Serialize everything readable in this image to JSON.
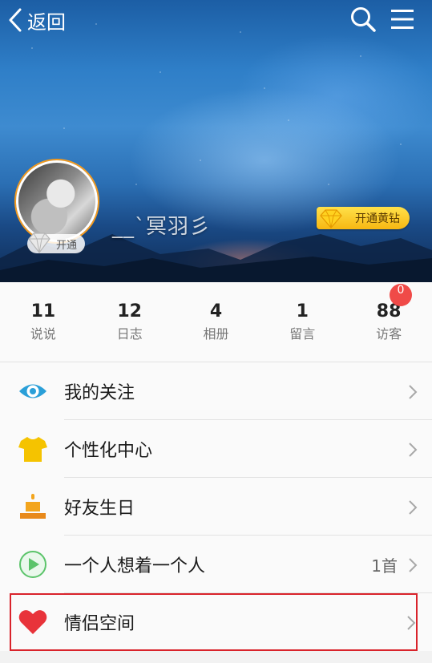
{
  "header": {
    "back_label": "返回",
    "nickname": "__`冥羽彡",
    "avatar_badge_label": "开通",
    "vip_button_label": "开通黄钻"
  },
  "stats": [
    {
      "count": "11",
      "label": "说说"
    },
    {
      "count": "12",
      "label": "日志"
    },
    {
      "count": "4",
      "label": "相册"
    },
    {
      "count": "1",
      "label": "留言"
    },
    {
      "count": "88",
      "label": "访客"
    }
  ],
  "visitor_badge": "0",
  "menu": [
    {
      "label": "我的关注",
      "icon": "eye-icon",
      "extra": ""
    },
    {
      "label": "个性化中心",
      "icon": "tshirt-icon",
      "extra": ""
    },
    {
      "label": "好友生日",
      "icon": "cake-icon",
      "extra": ""
    },
    {
      "label": "一个人想着一个人",
      "icon": "play-icon",
      "extra": "1首"
    },
    {
      "label": "情侣空间",
      "icon": "heart-icon",
      "extra": ""
    }
  ],
  "colors": {
    "accent_blue": "#2a9fd8",
    "tshirt_yellow": "#f5c300",
    "cake_orange": "#f3a51d",
    "play_green": "#5bc46a",
    "heart_red": "#e8333a",
    "highlight_border": "#d9232b",
    "badge_red": "#f04a48"
  }
}
